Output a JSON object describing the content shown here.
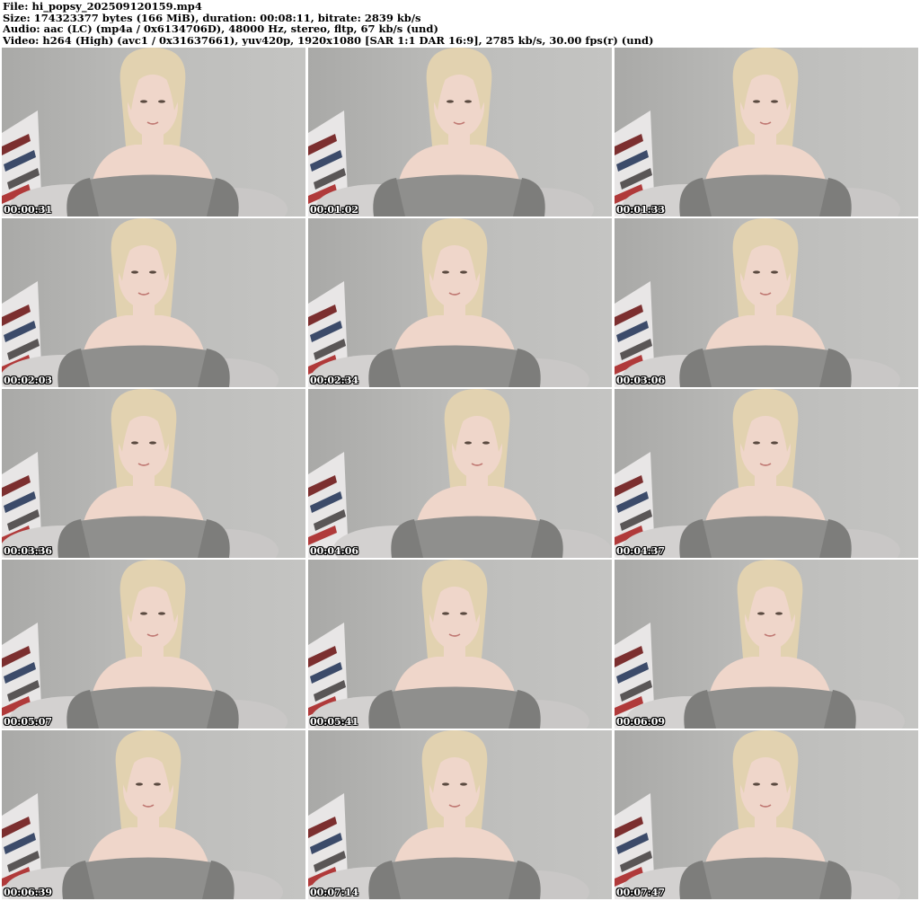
{
  "header": {
    "file": "File: hi_popsy_202509120159.mp4",
    "size": "Size: 174323377 bytes (166 MiB), duration: 00:08:11, bitrate: 2839 kb/s",
    "audio": "Audio: aac (LC) (mp4a / 0x6134706D), 48000 Hz, stereo, fltp, 67 kb/s (und)",
    "video": "Video: h264 (High) (avc1 / 0x31637661), yuv420p, 1920x1080 [SAR 1:1 DAR 16:9], 2785 kb/s, 30.00 fps(r) (und)"
  },
  "thumbnails": [
    {
      "timestamp": "00:00:31"
    },
    {
      "timestamp": "00:01:02"
    },
    {
      "timestamp": "00:01:33"
    },
    {
      "timestamp": "00:02:03"
    },
    {
      "timestamp": "00:02:34"
    },
    {
      "timestamp": "00:03:06"
    },
    {
      "timestamp": "00:03:36"
    },
    {
      "timestamp": "00:04:06"
    },
    {
      "timestamp": "00:04:37"
    },
    {
      "timestamp": "00:05:07"
    },
    {
      "timestamp": "00:05:41"
    },
    {
      "timestamp": "00:06:09"
    },
    {
      "timestamp": "00:06:39"
    },
    {
      "timestamp": "00:07:14"
    },
    {
      "timestamp": "00:07:47"
    }
  ],
  "colors": {
    "wall": "#bdbdbb",
    "hair": "#e2d2b0",
    "skin": "#efd6ca",
    "top": "#8f8f8d",
    "timestamp_text": "#ffffff",
    "timestamp_outline": "#000000"
  }
}
